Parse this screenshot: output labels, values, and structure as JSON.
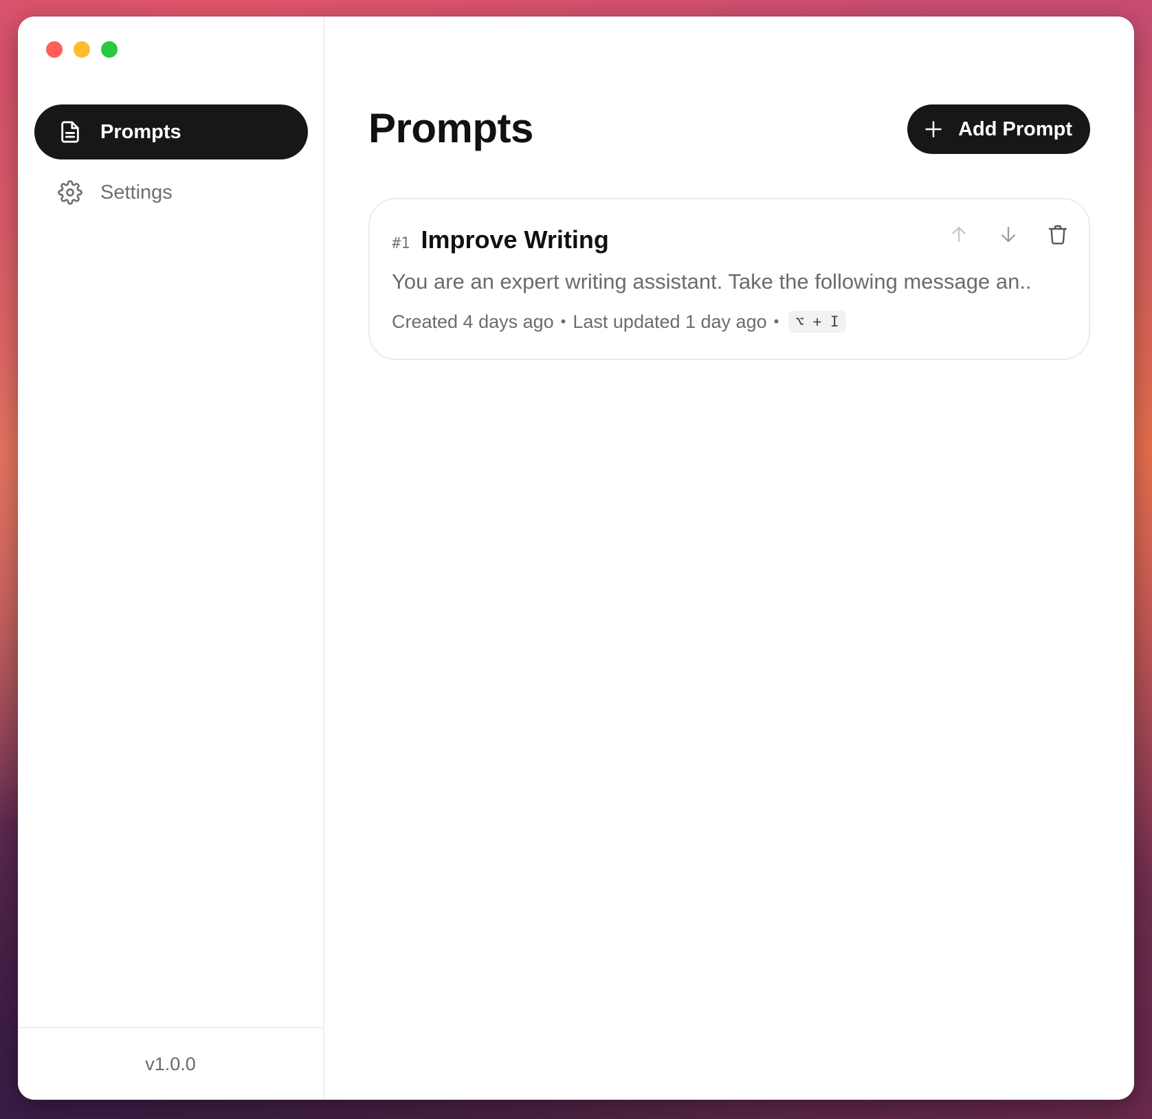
{
  "window": {
    "traffic_lights": {
      "close": "#ff5f57",
      "minimize": "#febc2e",
      "zoom": "#28c840"
    }
  },
  "sidebar": {
    "items": [
      {
        "label": "Prompts",
        "icon": "document-icon",
        "active": true
      },
      {
        "label": "Settings",
        "icon": "gear-icon",
        "active": false
      }
    ],
    "version": "v1.0.0"
  },
  "main": {
    "title": "Prompts",
    "add_button_label": "Add Prompt",
    "prompts": [
      {
        "number": "#1",
        "title": "Improve Writing",
        "preview": "You are an expert writing assistant. Take the following message an..",
        "created": "Created 4 days ago",
        "updated": "Last updated 1 day ago",
        "separator": "•",
        "shortcut": "⌥ + I"
      }
    ]
  },
  "colors": {
    "accent_dark": "#171717",
    "muted_text": "#6b6b6b",
    "border": "#ebebeb"
  }
}
